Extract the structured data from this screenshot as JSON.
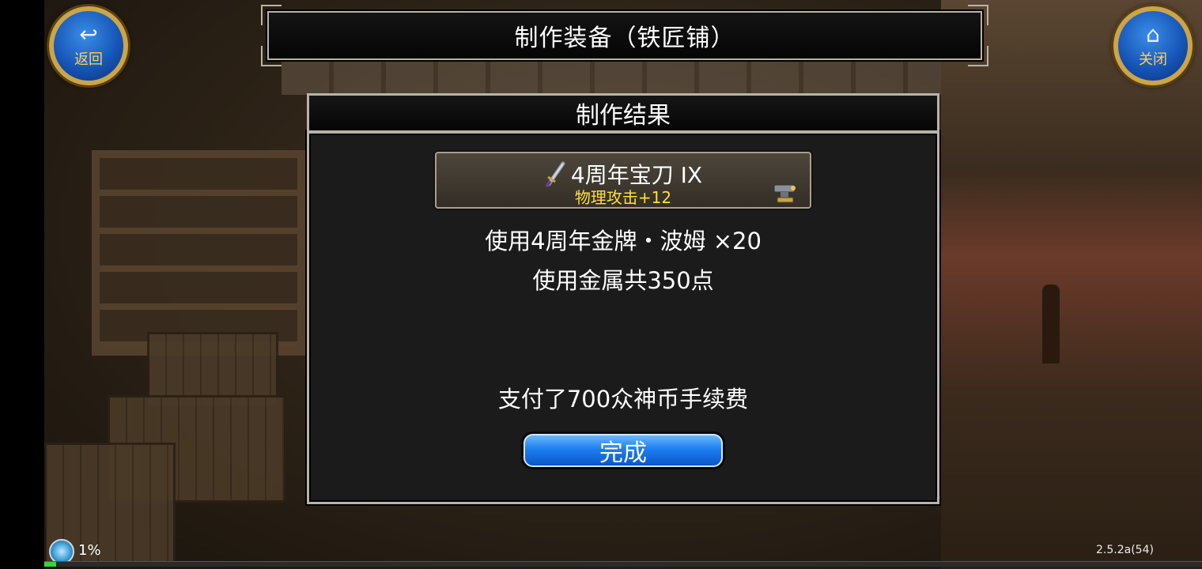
{
  "header": {
    "title": "制作装备（铁匠铺）",
    "back_label": "返回",
    "back_icon": "return-arrow-icon",
    "close_label": "关闭",
    "close_icon": "home-icon"
  },
  "result": {
    "heading": "制作结果",
    "item": {
      "name": "4周年宝刀 IX",
      "stat": "物理攻击+12",
      "icon": "sword-icon",
      "badge_icon": "anvil-icon"
    },
    "material_line": "使用4周年金牌・波姆 ×20",
    "metal_line": "使用金属共350点",
    "fee_line": "支付了700众神币手续费",
    "done_label": "完成"
  },
  "footer": {
    "percent": "1%",
    "progress": 0.01,
    "version": "2.5.2a(54)"
  },
  "colors": {
    "stat_yellow": "#ffdf3a",
    "button_blue": "#1e7ff0",
    "frame_gold": "#caa54a"
  }
}
